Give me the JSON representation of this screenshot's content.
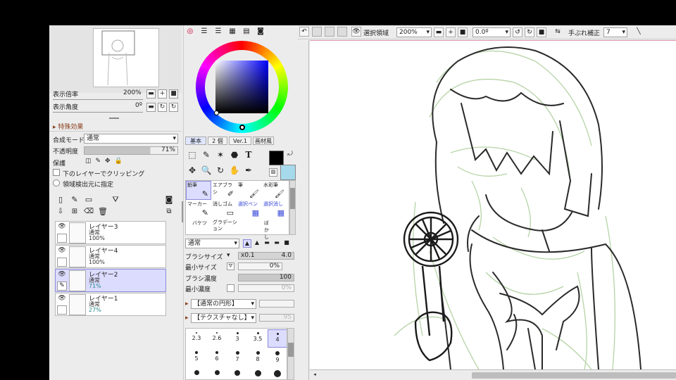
{
  "navigator": {
    "zoom_label": "表示倍率",
    "zoom_value": "200%",
    "angle_label": "表示角度",
    "angle_value": "0º"
  },
  "effects": {
    "header": "特殊効果"
  },
  "layer_props": {
    "blend_label": "合成モード",
    "blend_value": "通常",
    "opacity_label": "不透明度",
    "opacity_value": "71%",
    "protect_label": "保護",
    "clip_label": "下のレイヤーでクリッピング",
    "select_src_label": "領域検出元に指定"
  },
  "layers": [
    {
      "name": "レイヤー3",
      "mode": "通常",
      "opacity": "100%"
    },
    {
      "name": "レイヤー4",
      "mode": "通常",
      "opacity": "100%"
    },
    {
      "name": "レイヤー2",
      "mode": "通常",
      "opacity": "71%"
    },
    {
      "name": "レイヤー1",
      "mode": "通常",
      "opacity": "27%"
    }
  ],
  "tool_tabs": {
    "basic": "基本",
    "two": "2 個",
    "ver1": "Ver.1",
    "material": "画材風"
  },
  "brushes": [
    {
      "name": "鉛筆",
      "icon": "✎"
    },
    {
      "name": "エアブラシ",
      "icon": "✐"
    },
    {
      "name": "筆",
      "icon": "🖌"
    },
    {
      "name": "水彩筆",
      "icon": "🖌"
    },
    {
      "name": "マーカー",
      "icon": "✎"
    },
    {
      "name": "消しゴム",
      "icon": "▭"
    },
    {
      "name": "選択ペン",
      "icon": "▦"
    },
    {
      "name": "選択消し",
      "icon": "▦"
    },
    {
      "name": "バケツ",
      "icon": ""
    },
    {
      "name": "グラデーション",
      "icon": ""
    },
    {
      "name": "ぼかし",
      "icon": ""
    }
  ],
  "brush_settings": {
    "blend_value": "通常",
    "size_label": "ブラシサイズ",
    "size_mult": "x0.1",
    "size_value": "4.0",
    "min_size_label": "最小サイズ",
    "min_size_value": "0%",
    "density_label": "ブラシ濃度",
    "density_value": "100",
    "min_density_label": "最小濃度",
    "min_density_value": "0%",
    "shape_value": "【通常の円形】",
    "texture_value": "【テクスチャなし】",
    "texture_num": "95"
  },
  "dot_sizes": [
    "2.3",
    "2.6",
    "3",
    "3.5",
    "4",
    "5",
    "6",
    "7",
    "8",
    "9",
    "",
    "",
    "",
    "",
    ""
  ],
  "toolbar": {
    "select_label": "選択領域",
    "zoom_value": "200%",
    "angle_value": "0.0º",
    "stabilizer_label": "手ぶれ補正",
    "stabilizer_value": "7"
  },
  "colors": {
    "accent": "#dcdcff",
    "primary": "#000000",
    "secondary": "#a6d9ec"
  }
}
